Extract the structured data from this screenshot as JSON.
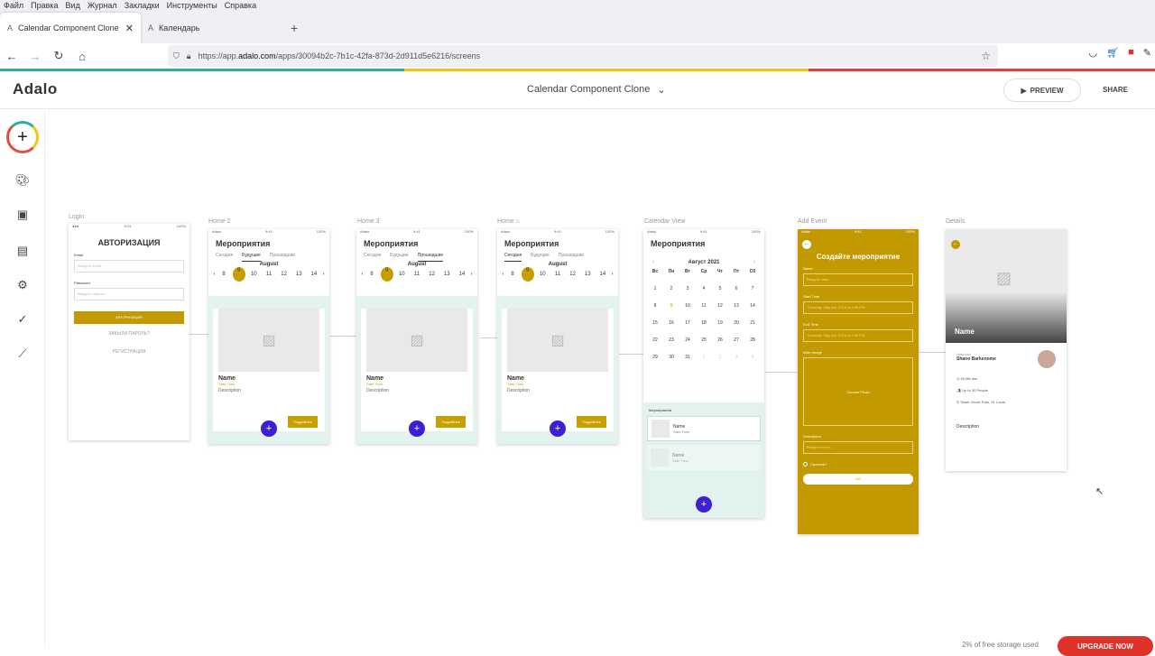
{
  "menu": [
    "Файл",
    "Правка",
    "Вид",
    "Журнал",
    "Закладки",
    "Инструменты",
    "Справка"
  ],
  "tabs": [
    {
      "label": "Calendar Component Clone",
      "fav": "A"
    },
    {
      "label": "Календарь",
      "fav": "A"
    }
  ],
  "url": {
    "prefix": "https://app.",
    "domain": "adalo.com",
    "rest": "/apps/30094b2c-7b1c-42fa-873d-2d911d5e6216/screens"
  },
  "app": {
    "logo": "Adalo",
    "title": "Calendar Component Clone",
    "preview": "PREVIEW",
    "share": "SHARE"
  },
  "screens": {
    "login": {
      "label": "Login",
      "title": "АВТОРИЗАЦИЯ",
      "email_label": "Email",
      "email_ph": "Введите email...",
      "password_label": "Password",
      "password_ph": "Введите пароль...",
      "submit": "АВТОРИЗАЦИЯ",
      "forgot": "ЗАБЫЛИ ПАРОЛЬ?",
      "register": "РЕГИСТРАЦИЯ"
    },
    "home2": {
      "label": "Home 2"
    },
    "home3": {
      "label": "Home 3"
    },
    "home": {
      "label": "Home"
    },
    "common": {
      "title": "Мероприятия",
      "tab1": "Сегодня",
      "tab2": "Будущие",
      "tab3": "Прошедшие",
      "month": "August",
      "days": [
        "8",
        "9",
        "10",
        "11",
        "12",
        "13",
        "14"
      ],
      "name": "Name",
      "start": "Start Time",
      "desc": "Description",
      "more": "Подробнее",
      "fab": "+"
    },
    "calendar": {
      "label": "Calendar View",
      "title": "Мероприятия",
      "month": "Август 2021",
      "weekdays": [
        "Вс",
        "Пн",
        "Вт",
        "Ср",
        "Чт",
        "Пт",
        "Сб"
      ],
      "dates": [
        "1",
        "2",
        "3",
        "4",
        "5",
        "6",
        "7",
        "8",
        "9",
        "10",
        "11",
        "12",
        "13",
        "14",
        "15",
        "16",
        "17",
        "18",
        "19",
        "20",
        "21",
        "22",
        "23",
        "24",
        "25",
        "26",
        "27",
        "28",
        "29",
        "30",
        "31",
        "1",
        "2",
        "3",
        "4"
      ],
      "list_title": "Мероприятия",
      "item_name": "Name",
      "item_start": "Start Time"
    },
    "add": {
      "label": "Add Event",
      "title": "Создайте мероприятие",
      "name": "Name",
      "name_ph": "Введите имя...",
      "start": "Start Time",
      "start_ph": "Thursday, May 4th, 2018 at 4:50 PM",
      "end": "End Time",
      "end_ph": "Thursday, May 4th, 2018 at 4:50 PM",
      "image": "Main Image",
      "choose": "Choose Photo",
      "desc": "Description",
      "desc_ph": "Введите текст...",
      "check": "Срочное?",
      "go": "GO"
    },
    "details": {
      "label": "Details",
      "name": "Name",
      "host_small": "Host info",
      "host": "Shano Barkenome",
      "r1": "00 Mb doc",
      "r2": "Up to 30 People",
      "r3": "Tower Grove Park, St. Louis",
      "desc": "Description"
    }
  },
  "footer": {
    "storage": "2% of free storage used",
    "upgrade": "UPGRADE NOW"
  }
}
